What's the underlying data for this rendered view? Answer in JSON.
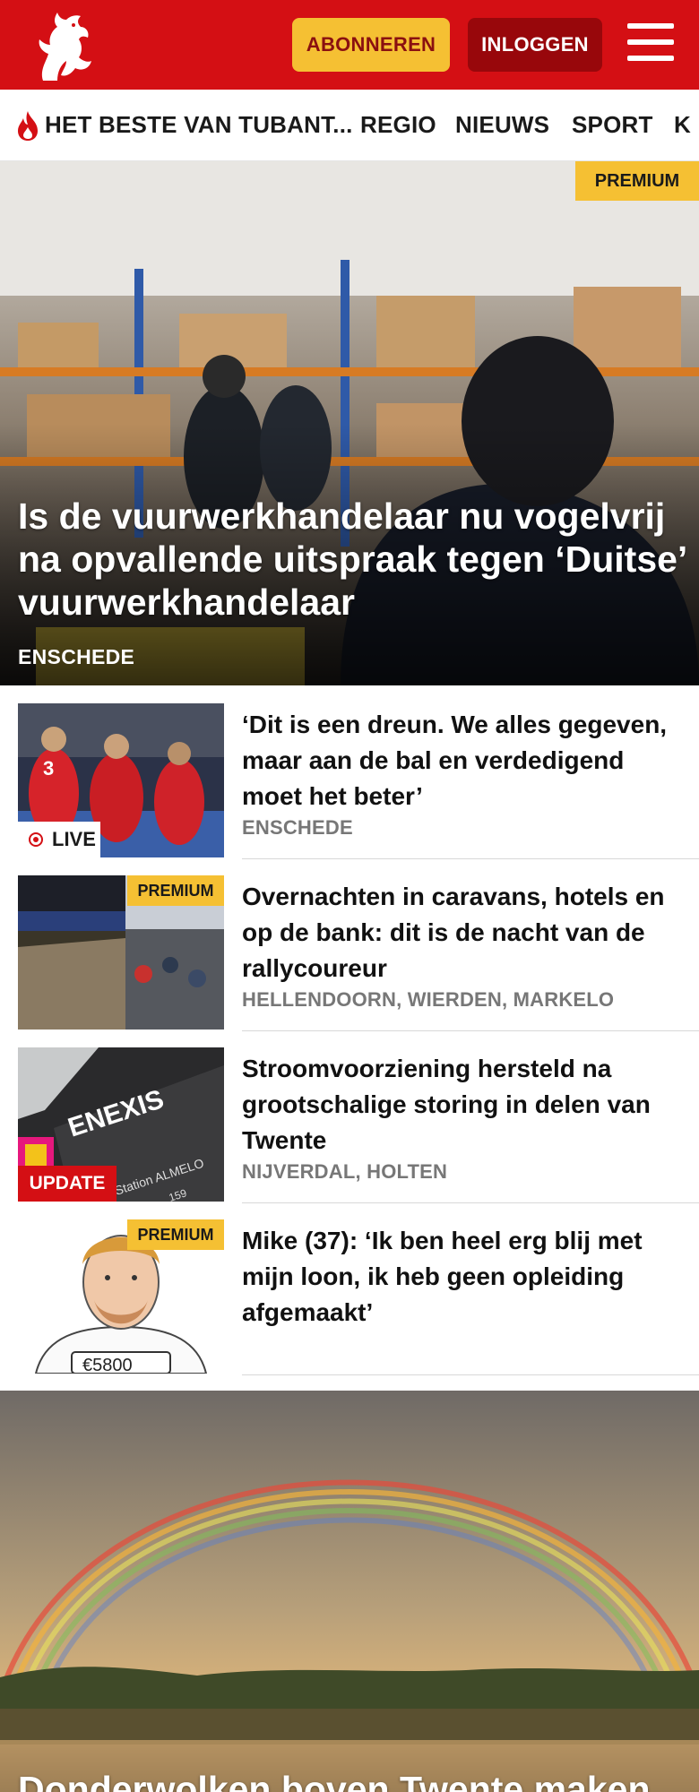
{
  "header": {
    "subscribe_label": "ABONNEREN",
    "login_label": "INLOGGEN"
  },
  "nav": {
    "items": [
      "HET BESTE VAN TUBANT...",
      "REGIO",
      "NIEUWS",
      "SPORT",
      "K"
    ]
  },
  "hero": {
    "badge": "PREMIUM",
    "title": "Is de vuurwerkhandelaar nu vogelvrij na opvallende uitspraak tegen ‘Duitse’ vuurwerkhandelaar",
    "location": "ENSCHEDE"
  },
  "articles": [
    {
      "title": "‘Dit is een dreun. We alles gegeven, maar aan de bal en verdedigend moet het beter’",
      "location": "ENSCHEDE",
      "badge": "LIVE"
    },
    {
      "title": "Overnachten in caravans, hotels en op de bank: dit is de nacht van de rallycoureur",
      "location": "HELLENDOORN, WIERDEN, MARKELO",
      "badge": "PREMIUM"
    },
    {
      "title": "Stroomvoorziening hersteld na grootschalige storing in delen van Twente",
      "location": "NIJVERDAL, HOLTEN",
      "badge": "UPDATE",
      "thumb_text": [
        "ENEXIS",
        "Station ALMELO",
        "159"
      ]
    },
    {
      "title": "Mike (37): ‘Ik ben heel erg blij met mijn loon, ik heb geen opleiding afgemaakt’",
      "location": "",
      "badge": "PREMIUM",
      "thumb_text": "€5800"
    }
  ],
  "bottom_story": {
    "title": "Donderwolken boven Twente maken"
  },
  "colors": {
    "brand_red": "#d40f14",
    "login_dark_red": "#98070b",
    "premium_yellow": "#f5c033",
    "location_grey": "#777777"
  },
  "icons": [
    "horse-logo-icon",
    "menu-icon",
    "flame-icon",
    "live-dot-icon"
  ]
}
